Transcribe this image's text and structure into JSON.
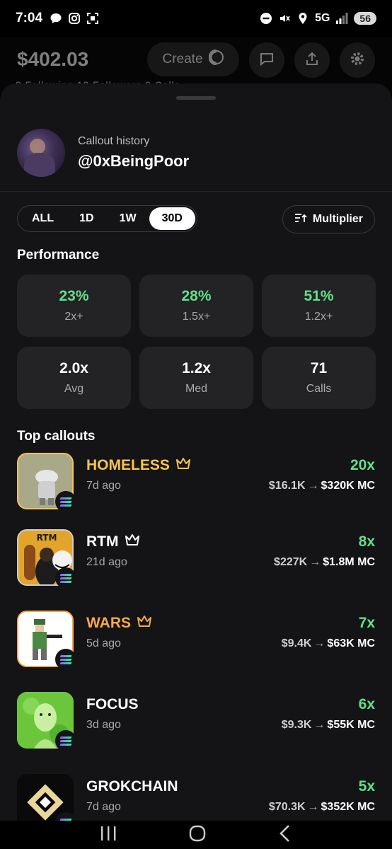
{
  "status": {
    "time": "7:04",
    "network": "5G",
    "battery": "56"
  },
  "background": {
    "balance": "$402.03",
    "create_label": "Create",
    "sub": "2 Following  12 Followers  2 Calls"
  },
  "profile": {
    "subtitle": "Callout history",
    "handle": "@0xBeingPoor"
  },
  "ranges": [
    {
      "label": "ALL",
      "active": false
    },
    {
      "label": "1D",
      "active": false
    },
    {
      "label": "1W",
      "active": false
    },
    {
      "label": "30D",
      "active": true
    }
  ],
  "multiplier_label": "Multiplier",
  "performance": {
    "title": "Performance",
    "stats": [
      {
        "value": "23%",
        "label": "2x+",
        "accent": "#63e08a"
      },
      {
        "value": "28%",
        "label": "1.5x+",
        "accent": "#63e08a"
      },
      {
        "value": "51%",
        "label": "1.2x+",
        "accent": "#63e08a"
      },
      {
        "value": "2.0x",
        "label": "Avg"
      },
      {
        "value": "1.2x",
        "label": "Med"
      },
      {
        "value": "71",
        "label": "Calls"
      }
    ]
  },
  "top": {
    "title": "Top callouts",
    "items": [
      {
        "name": "HOMELESS",
        "ago": "7d ago",
        "multiplier": "20x",
        "from": "$16.1K",
        "to": "$320K MC",
        "crown": true,
        "name_color": "#f7c548"
      },
      {
        "name": "RTM",
        "ago": "21d ago",
        "multiplier": "8x",
        "from": "$227K",
        "to": "$1.8M MC",
        "crown": true,
        "name_color": "#ffffff"
      },
      {
        "name": "WARS",
        "ago": "5d ago",
        "multiplier": "7x",
        "from": "$9.4K",
        "to": "$63K MC",
        "crown": true,
        "name_color": "#f8a84a"
      },
      {
        "name": "FOCUS",
        "ago": "3d ago",
        "multiplier": "6x",
        "from": "$9.3K",
        "to": "$55K MC",
        "crown": false,
        "name_color": "#ffffff"
      },
      {
        "name": "GROKCHAIN",
        "ago": "7d ago",
        "multiplier": "5x",
        "from": "$70.3K",
        "to": "$352K MC",
        "crown": false,
        "name_color": "#ffffff"
      }
    ]
  },
  "arrow_glyph": "→"
}
